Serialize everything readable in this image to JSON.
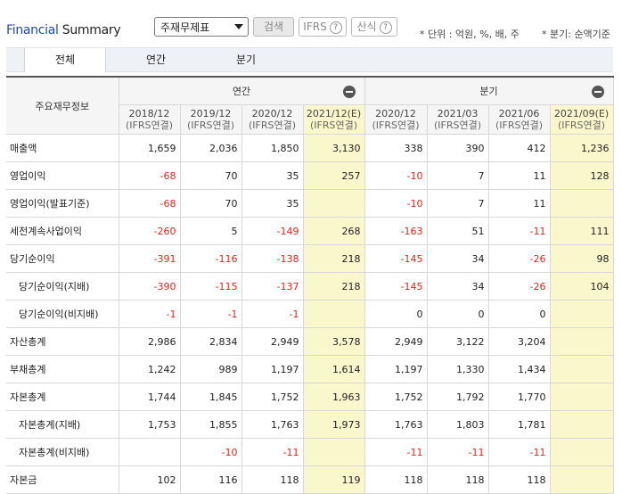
{
  "header": {
    "title_part1": "Financial",
    "title_part2": " Summary",
    "select_value": "주재무제표",
    "search_button": "검색",
    "ifrs_button": "IFRS",
    "formula_button": "산식",
    "help_glyph": "?",
    "unit_note": "* 단위 : 억원, %, 배, 주",
    "quarter_note": "* 분기: 순액기준"
  },
  "tabs": [
    "전체",
    "연간",
    "분기"
  ],
  "table": {
    "row_header_label": "주요재무정보",
    "group_annual": "연간",
    "group_quarter": "분기",
    "columns": [
      {
        "period": "2018/12",
        "basis": "(IFRS연결)",
        "estimate": false
      },
      {
        "period": "2019/12",
        "basis": "(IFRS연결)",
        "estimate": false
      },
      {
        "period": "2020/12",
        "basis": "(IFRS연결)",
        "estimate": false
      },
      {
        "period": "2021/12(E)",
        "basis": "(IFRS연결)",
        "estimate": true
      },
      {
        "period": "2020/12",
        "basis": "(IFRS연결)",
        "estimate": false
      },
      {
        "period": "2021/03",
        "basis": "(IFRS연결)",
        "estimate": false
      },
      {
        "period": "2021/06",
        "basis": "(IFRS연결)",
        "estimate": false
      },
      {
        "period": "2021/09(E)",
        "basis": "(IFRS연결)",
        "estimate": true
      }
    ],
    "rows": [
      {
        "label": "매출액",
        "indent": false,
        "values": [
          "1,659",
          "2,036",
          "1,850",
          "3,130",
          "338",
          "390",
          "412",
          "1,236"
        ]
      },
      {
        "label": "영업이익",
        "indent": false,
        "values": [
          "-68",
          "70",
          "35",
          "257",
          "-10",
          "7",
          "11",
          "128"
        ]
      },
      {
        "label": "영업이익(발표기준)",
        "indent": false,
        "values": [
          "-68",
          "70",
          "35",
          "",
          "-10",
          "7",
          "11",
          ""
        ]
      },
      {
        "label": "세전계속사업이익",
        "indent": false,
        "values": [
          "-260",
          "5",
          "-149",
          "268",
          "-163",
          "51",
          "-11",
          "111"
        ]
      },
      {
        "label": "당기순이익",
        "indent": false,
        "values": [
          "-391",
          "-116",
          "-138",
          "218",
          "-145",
          "34",
          "-26",
          "98"
        ]
      },
      {
        "label": "당기순이익(지배)",
        "indent": true,
        "values": [
          "-390",
          "-115",
          "-137",
          "218",
          "-145",
          "34",
          "-26",
          "104"
        ]
      },
      {
        "label": "당기순이익(비지배)",
        "indent": true,
        "values": [
          "-1",
          "-1",
          "-1",
          "",
          "0",
          "0",
          "0",
          ""
        ]
      },
      {
        "label": "자산총계",
        "indent": false,
        "values": [
          "2,986",
          "2,834",
          "2,949",
          "3,578",
          "2,949",
          "3,122",
          "3,204",
          ""
        ]
      },
      {
        "label": "부채총계",
        "indent": false,
        "values": [
          "1,242",
          "989",
          "1,197",
          "1,614",
          "1,197",
          "1,330",
          "1,434",
          ""
        ]
      },
      {
        "label": "자본총계",
        "indent": false,
        "values": [
          "1,744",
          "1,845",
          "1,752",
          "1,963",
          "1,752",
          "1,792",
          "1,770",
          ""
        ]
      },
      {
        "label": "자본총계(지배)",
        "indent": true,
        "values": [
          "1,753",
          "1,855",
          "1,763",
          "1,973",
          "1,763",
          "1,803",
          "1,781",
          ""
        ]
      },
      {
        "label": "자본총계(비지배)",
        "indent": true,
        "values": [
          "",
          "-10",
          "-11",
          "",
          "-11",
          "-11",
          "-11",
          ""
        ]
      },
      {
        "label": "자본금",
        "indent": false,
        "values": [
          "102",
          "116",
          "118",
          "119",
          "118",
          "118",
          "118",
          ""
        ]
      }
    ]
  },
  "colors": {
    "negative": "#e0251b",
    "estimate_bg": "#fbf7cd",
    "title_blue": "#1f4aa8"
  }
}
